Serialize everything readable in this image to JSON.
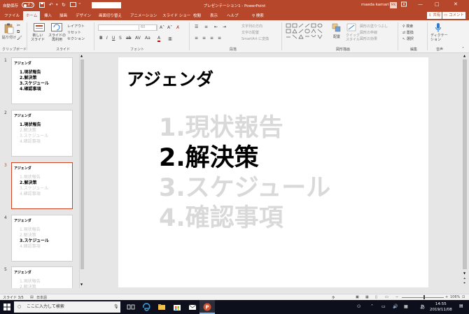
{
  "window": {
    "autosave_label": "自動保存",
    "autosave_state": "オフ",
    "doc_title": "プレゼンテーション1 - PowerPoint",
    "user_name": "maeda kamari",
    "user_initials": "MK",
    "minimize": "—",
    "maximize": "□",
    "close": "✕"
  },
  "tabs": {
    "items": [
      "ファイル",
      "ホーム",
      "挿入",
      "描画",
      "デザイン",
      "画面切り替え",
      "アニメーション",
      "スライド ショー",
      "校閲",
      "表示",
      "ヘルプ"
    ],
    "search": "検索",
    "share": "共有",
    "comment": "コメント"
  },
  "ribbon": {
    "paste": "貼り付け",
    "new_slide": "新しい\nスライド",
    "reuse_slide": "スライドの\n再利用",
    "layout": "レイアウト",
    "reset": "リセット",
    "section": "セクション",
    "font_size": "60",
    "text_direction": "文字列の方向",
    "text_align": "文字の配置",
    "smartart": "SmartArt に変換",
    "arrange": "配置",
    "quick_styles": "クイック\nスタイル",
    "shape_fill": "図形の塗りつぶし",
    "shape_outline": "図形の枠線",
    "shape_effects": "図形の効果",
    "find": "検索",
    "replace": "置換",
    "select": "選択",
    "dictation": "ディクテー\nション",
    "groups": [
      "クリップボード",
      "スライド",
      "フォント",
      "段落",
      "図形描画",
      "編集",
      "音声"
    ]
  },
  "slides": [
    {
      "num": "1",
      "title": "アジェンダ",
      "items": [
        "1.現状報告",
        "2.解決策",
        "3.スケジュール",
        "4.確認事項"
      ],
      "active": -1
    },
    {
      "num": "2",
      "title": "アジェンダ",
      "items": [
        "1.現状報告",
        "2.解決策",
        "3.スケジュール",
        "4.確認事項"
      ],
      "active": 0
    },
    {
      "num": "3",
      "title": "アジェンダ",
      "items": [
        "1.現状報告",
        "2.解決策",
        "3.スケジュール",
        "4.確認事項"
      ],
      "active": 1
    },
    {
      "num": "4",
      "title": "アジェンダ",
      "items": [
        "1.現状報告",
        "2.解決策",
        "3.スケジュール",
        "4.確認事項"
      ],
      "active": 2
    },
    {
      "num": "5",
      "title": "アジェンダ",
      "items": [
        "1.現状報告",
        "2.解決策",
        "3.スケジュール"
      ],
      "active": -1
    }
  ],
  "current_slide": {
    "title": "アジェンダ",
    "items": [
      "1.現状報告",
      "2.解決策",
      "3.スケジュール",
      "4.確認事項"
    ],
    "active": 1
  },
  "status": {
    "slide_info": "スライド 3/5",
    "language": "日本語",
    "notes": "ノート",
    "zoom": "106%"
  },
  "taskbar": {
    "search_placeholder": "ここに入力して検索",
    "time": "14:55",
    "date": "2019/11/08",
    "ime": "あ"
  },
  "colors": {
    "accent": "#b7472a",
    "selected_border": "#d04423",
    "dim_text": "#d9d9d9"
  }
}
